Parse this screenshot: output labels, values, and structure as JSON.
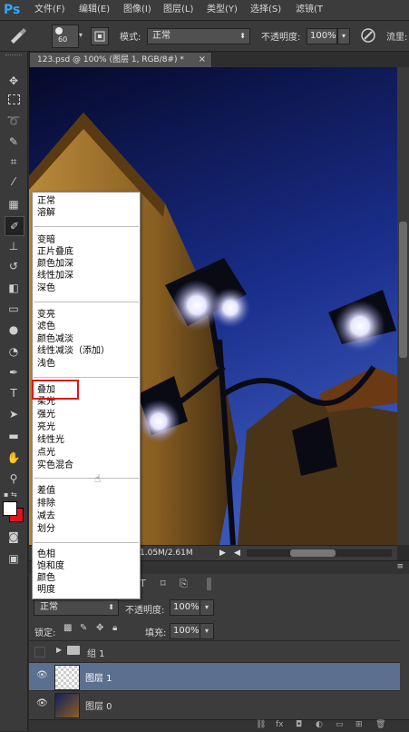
{
  "app": {
    "logo": "Ps"
  },
  "menu": [
    "文件(F)",
    "编辑(E)",
    "图像(I)",
    "图层(L)",
    "类型(Y)",
    "选择(S)",
    "滤镜(T"
  ],
  "options": {
    "brush_size": "60",
    "mode_label": "模式:",
    "mode_value": "正常",
    "opacity_label": "不透明度:",
    "opacity_value": "100%",
    "flow_label": "流里:"
  },
  "document": {
    "tab_title": "123.psd @ 100% (图层 1, RGB/8#) *",
    "close": "×"
  },
  "status": {
    "doc_size": "1.05M/2.61M"
  },
  "blend_menu": {
    "groups": [
      [
        "正常",
        "溶解"
      ],
      [
        "变暗",
        "正片叠底",
        "颜色加深",
        "线性加深",
        "深色"
      ],
      [
        "变亮",
        "滤色",
        "颜色减淡",
        "线性减淡（添加）",
        "浅色"
      ],
      [
        "叠加",
        "柔光",
        "强光",
        "亮光",
        "线性光",
        "点光",
        "实色混合"
      ],
      [
        "差值",
        "排除",
        "减去",
        "划分"
      ],
      [
        "色相",
        "饱和度",
        "颜色",
        "明度"
      ]
    ],
    "highlighted": "叠加"
  },
  "layers_panel": {
    "blend_mode": "正常",
    "opacity_label": "不透明度:",
    "opacity_value": "100%",
    "lock_label": "锁定:",
    "fill_label": "填充:",
    "fill_value": "100%",
    "layers": [
      {
        "name": "组 1",
        "type": "group",
        "visible": false,
        "selected": false
      },
      {
        "name": "图层 1",
        "type": "layer",
        "visible": true,
        "selected": true
      },
      {
        "name": "图层 0",
        "type": "image",
        "visible": true,
        "selected": false
      }
    ]
  },
  "colors": {
    "highlight_border": "#e0141b",
    "selected_row": "#5b6f8f",
    "foreground": "#ffffff",
    "background": "#e0141b"
  }
}
